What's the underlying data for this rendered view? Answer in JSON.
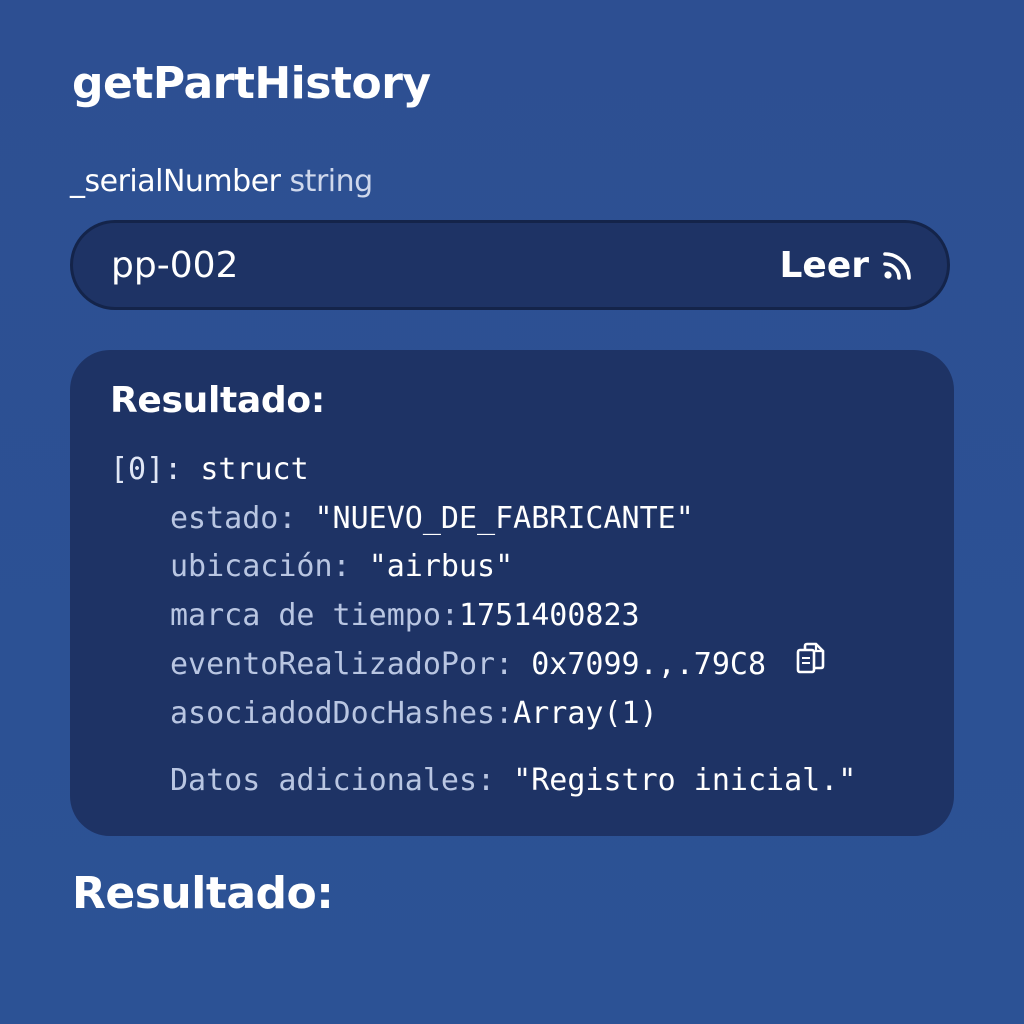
{
  "function_name": "getPartHistory",
  "param": {
    "name": "_serialNumber",
    "type": "string"
  },
  "input": {
    "value": "pp-002"
  },
  "read_button": {
    "label": "Leer",
    "icon": "rss-feed-icon"
  },
  "result": {
    "heading": "Resultado:",
    "index": "[0]:",
    "struct_label": "struct",
    "fields": [
      {
        "key": "estado:",
        "value": "\"NUEVO_DE_FABRICANTE\""
      },
      {
        "key": "ubicación:",
        "value": "\"airbus\""
      },
      {
        "key": "marca de tiempo:",
        "value": "1751400823"
      },
      {
        "key": "eventoRealizadoPor:",
        "value": "0x7099.,.79C8",
        "icon": "copy-icon"
      },
      {
        "key": "asociadodDocHashes:",
        "value": "Array(1)"
      },
      {
        "key": "Datos adicionales:",
        "value": "\"Registro inicial.\""
      }
    ]
  },
  "bottom_heading": "Resultado:",
  "colors": {
    "background": "#2d4f92",
    "card": "#1e3365",
    "key_text": "#b9c6e2"
  }
}
